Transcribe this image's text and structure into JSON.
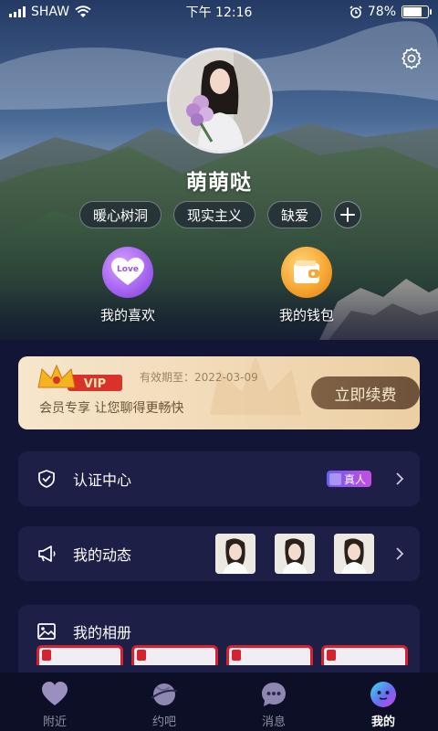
{
  "status_bar": {
    "carrier": "SHAW",
    "time": "下午 12:16",
    "battery": "78%",
    "battery_level": 0.78
  },
  "profile": {
    "nickname": "萌萌哒",
    "tags": [
      "暖心树洞",
      "现实主义",
      "缺爱"
    ],
    "add_tag_icon": "plus-icon",
    "avatar_icon": "user-photo"
  },
  "quick_actions": [
    {
      "label": "我的喜欢",
      "icon": "heart-love-icon",
      "icon_text": "Love",
      "color": "#a867f2"
    },
    {
      "label": "我的钱包",
      "icon": "wallet-icon",
      "color": "#f7a733"
    }
  ],
  "vip": {
    "badge": "VIP",
    "expiry": "有效期至：2022-03-09",
    "description": "会员专享  让您聊得更畅快",
    "renew_button": "立即续费"
  },
  "menu": {
    "verify": {
      "title": "认证中心",
      "badge": "真人",
      "icon": "shield-check-icon"
    },
    "moments": {
      "title": "我的动态",
      "icon": "megaphone-icon",
      "thumb_count": 3
    },
    "album": {
      "title": "我的相册",
      "icon": "image-icon"
    }
  },
  "tabbar": [
    {
      "label": "附近",
      "icon": "heart-icon",
      "active": false
    },
    {
      "label": "约吧",
      "icon": "planet-icon",
      "active": false
    },
    {
      "label": "消息",
      "icon": "chat-bubble-icon",
      "active": false
    },
    {
      "label": "我的",
      "icon": "smiley-face-icon",
      "active": true
    }
  ],
  "colors": {
    "background": "#131536",
    "accent_purple": "#a867f2",
    "accent_gold": "#f7a733",
    "vip_card": "#f1d9b5",
    "vip_button": "#6d523a"
  }
}
